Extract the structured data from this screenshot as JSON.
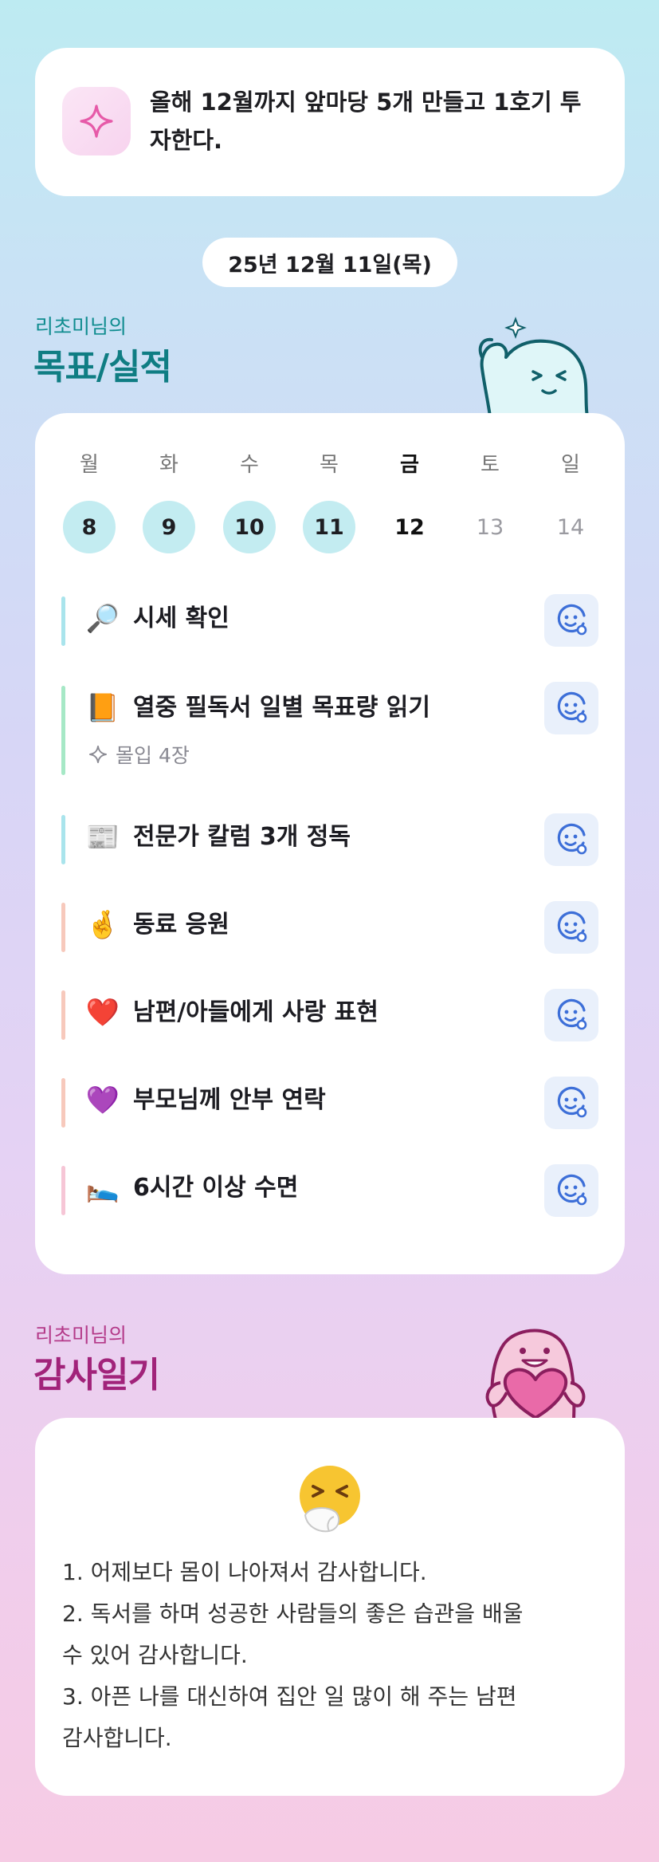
{
  "goal": {
    "text": "올해 12월까지 앞마당 5개 만들고 1호기 투자한다."
  },
  "date": "25년 12월 11일(목)",
  "goals_section": {
    "subtitle": "리초미님의",
    "title": "목표/실적"
  },
  "week": {
    "weekdays": [
      "월",
      "화",
      "수",
      "목",
      "금",
      "토",
      "일"
    ],
    "days": [
      {
        "num": "8",
        "state": "done"
      },
      {
        "num": "9",
        "state": "done"
      },
      {
        "num": "10",
        "state": "done"
      },
      {
        "num": "11",
        "state": "done"
      },
      {
        "num": "12",
        "state": "today"
      },
      {
        "num": "13",
        "state": "future"
      },
      {
        "num": "14",
        "state": "future"
      }
    ]
  },
  "tasks": [
    {
      "emoji": "🔎",
      "label": "시세 확인",
      "bar_color": "#a9e4ec"
    },
    {
      "emoji": "📙",
      "label": "열중 필독서 일별 목표량 읽기",
      "bar_color": "#a6e8c6",
      "sub": "몰입 4장"
    },
    {
      "emoji": "📰",
      "label": "전문가 칼럼 3개 정독",
      "bar_color": "#a9e4ec"
    },
    {
      "emoji": "🤞",
      "label": "동료 응원",
      "bar_color": "#f7c9bc"
    },
    {
      "emoji": "❤️",
      "label": "남편/아들에게 사랑 표현",
      "bar_color": "#f7c9bc"
    },
    {
      "emoji": "💜",
      "label": "부모님께 안부 연락",
      "bar_color": "#f7c9bc"
    },
    {
      "emoji": "🛌",
      "label": "6시간 이상 수면",
      "bar_color": "#f6c6d6"
    }
  ],
  "gratitude_section": {
    "subtitle": "리초미님의",
    "title": "감사일기"
  },
  "gratitude": {
    "mood_icon": "sneezing-face-icon",
    "lines": [
      "1. 어제보다 몸이 나아져서 감사합니다.",
      "2. 독서를 하며 성공한 사람들의 좋은 습관을 배울",
      "수 있어 감사합니다.",
      "3. 아픈 나를 대신하여 집안 일 많이 해 주는 남편",
      "감사합니다."
    ]
  },
  "colors": {
    "accent_teal": "#0f7d83",
    "accent_pink": "#a1237a",
    "done_day": "#c3ecf1",
    "face_button": "#e9f0fb"
  }
}
